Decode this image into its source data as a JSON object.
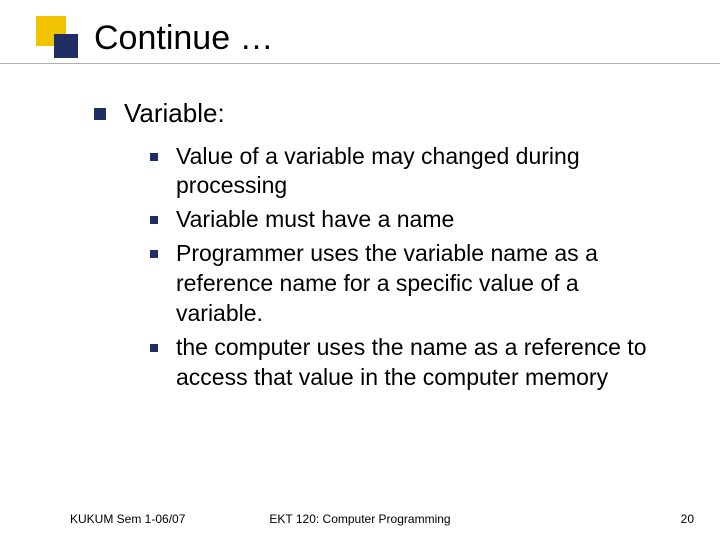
{
  "title": "Continue …",
  "heading": "Variable:",
  "items": [
    "Value of a variable may changed during processing",
    "Variable must have a name",
    "Programmer uses the variable name as a reference name for a specific value of a variable.",
    "the computer uses the name as a reference to access that value in the computer memory"
  ],
  "footer": {
    "left": "KUKUM Sem 1-06/07",
    "center": "EKT 120: Computer Programming",
    "pageno": "20"
  }
}
